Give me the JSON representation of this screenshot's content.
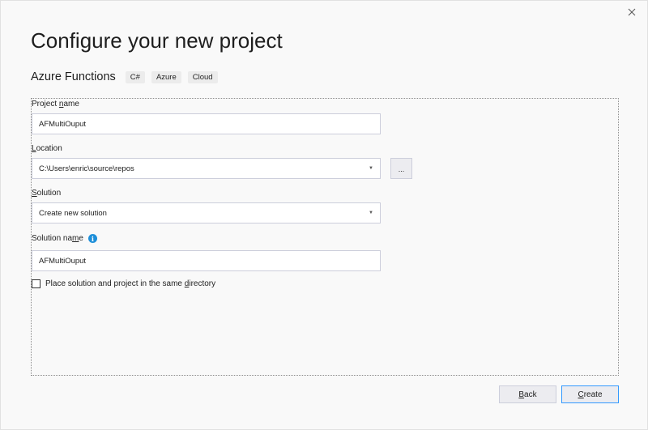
{
  "window": {
    "close_glyph": "✕"
  },
  "header": {
    "title": "Configure your new project",
    "template_name": "Azure Functions",
    "tags": [
      "C#",
      "Azure",
      "Cloud"
    ]
  },
  "form": {
    "project_name": {
      "label_pre": "Project ",
      "label_underline": "n",
      "label_post": "ame",
      "value": "AFMultiOuput"
    },
    "location": {
      "label_pre": "",
      "label_underline": "L",
      "label_post": "ocation",
      "value": "C:\\Users\\enric\\source\\repos",
      "browse_label": "..."
    },
    "solution": {
      "label_pre": "",
      "label_underline": "S",
      "label_post": "olution",
      "value": "Create new solution"
    },
    "solution_name": {
      "label_pre": "Solution na",
      "label_underline": "m",
      "label_post": "e",
      "value": "AFMultiOuput",
      "info_glyph": "i"
    },
    "same_directory": {
      "label_pre": "Place solution and project in the same ",
      "label_underline": "d",
      "label_post": "irectory",
      "checked": false
    }
  },
  "footer": {
    "back": {
      "underline": "B",
      "rest": "ack"
    },
    "create": {
      "underline": "C",
      "rest": "reate"
    }
  },
  "colors": {
    "accent": "#3399ff",
    "info": "#1e8fd9"
  }
}
